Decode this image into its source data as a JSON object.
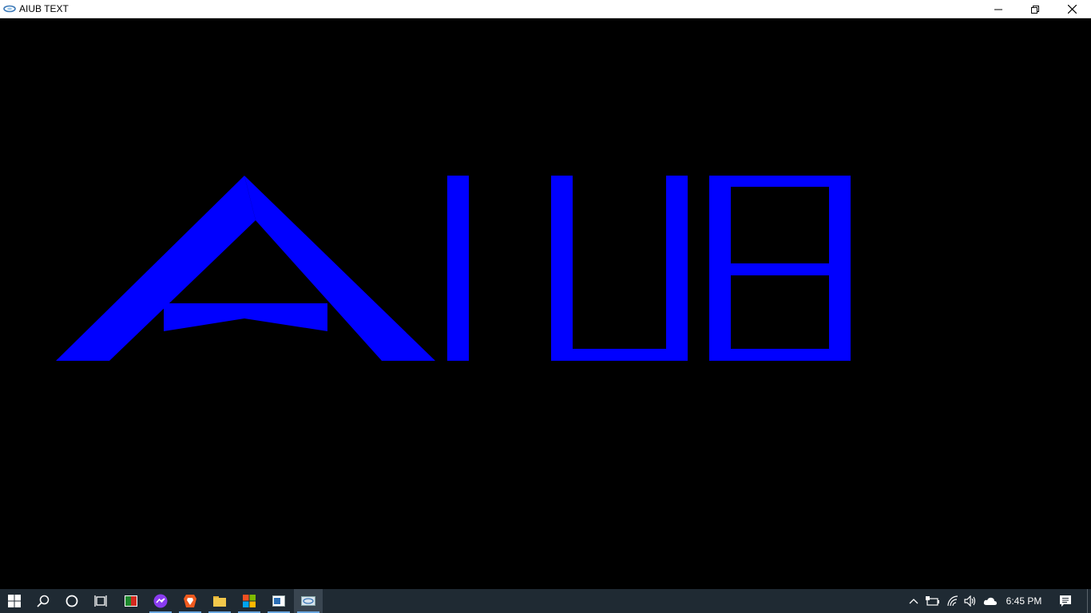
{
  "window": {
    "title": "AIUB TEXT",
    "app_icon": "opengl-app-icon",
    "controls": [
      "minimize-icon",
      "restore-icon",
      "close-icon"
    ]
  },
  "canvas": {
    "background": "#000000",
    "text": "AIUB",
    "text_color": "#0000ff"
  },
  "taskbar": {
    "background": "#1f2a33",
    "items": [
      {
        "name": "start-button",
        "icon": "windows-logo-icon"
      },
      {
        "name": "search-button",
        "icon": "search-icon"
      },
      {
        "name": "cortana-button",
        "icon": "circle-icon"
      },
      {
        "name": "task-view-button",
        "icon": "task-view-icon"
      },
      {
        "name": "app-1",
        "icon": "presentation-app-icon"
      },
      {
        "name": "app-messenger",
        "icon": "messenger-icon"
      },
      {
        "name": "app-brave",
        "icon": "brave-icon"
      },
      {
        "name": "app-file-explorer",
        "icon": "folder-icon"
      },
      {
        "name": "app-store",
        "icon": "store-icon"
      },
      {
        "name": "app-window",
        "icon": "window-app-icon"
      },
      {
        "name": "app-opengl",
        "icon": "opengl-app-icon"
      }
    ],
    "tray": [
      "chevron-up-icon",
      "battery-icon",
      "wifi-icon",
      "volume-icon",
      "onedrive-icon"
    ],
    "clock": "6:45 PM",
    "notification_icon": "action-center-icon"
  }
}
